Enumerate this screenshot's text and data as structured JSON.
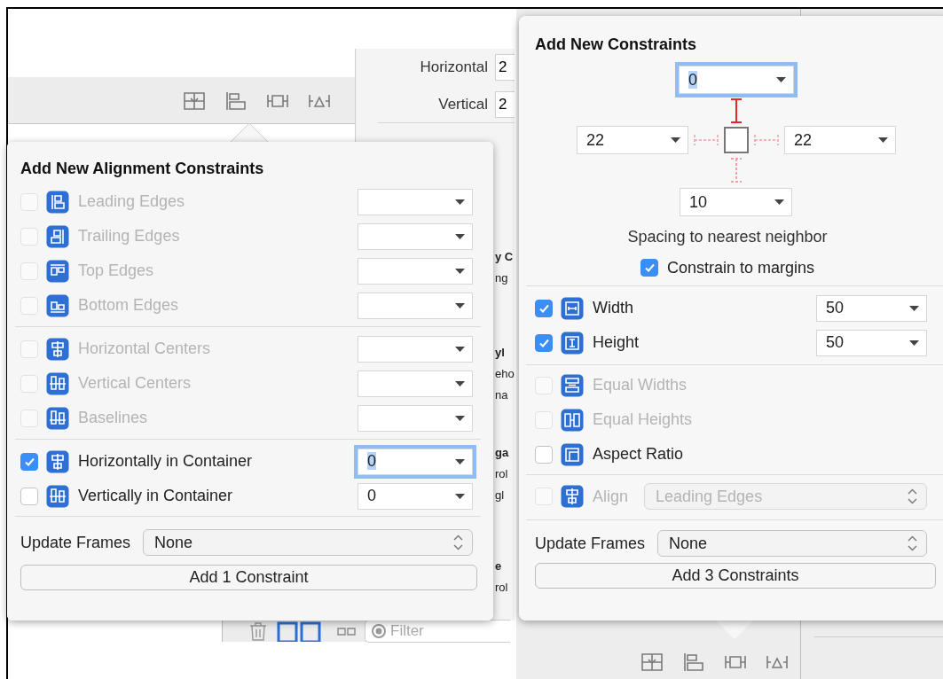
{
  "left_shot": {
    "inspector": {
      "fields": [
        {
          "label": "Horizontal",
          "value": "2"
        },
        {
          "label": "Vertical",
          "value": "2"
        }
      ],
      "fragments": [
        {
          "text": "y C",
          "kind": "heading"
        },
        {
          "text": "ng",
          "kind": "text"
        },
        {
          "text": "yl",
          "kind": "heading"
        },
        {
          "text": "eho",
          "kind": "text"
        },
        {
          "text": "na",
          "kind": "text"
        },
        {
          "text": "ga",
          "kind": "heading"
        },
        {
          "text": "rol",
          "kind": "text"
        },
        {
          "text": "gl",
          "kind": "text"
        },
        {
          "text": "e",
          "kind": "heading"
        },
        {
          "text": "rol",
          "kind": "text"
        }
      ]
    },
    "popover": {
      "title": "Add New Alignment Constraints",
      "groups": [
        [
          {
            "label": "Leading Edges",
            "checked": false,
            "disabled": true,
            "focused": false
          },
          {
            "label": "Trailing Edges",
            "checked": false,
            "disabled": true,
            "focused": false
          },
          {
            "label": "Top Edges",
            "checked": false,
            "disabled": true,
            "focused": false
          },
          {
            "label": "Bottom Edges",
            "checked": false,
            "disabled": true,
            "focused": false
          }
        ],
        [
          {
            "label": "Horizontal Centers",
            "checked": false,
            "disabled": true,
            "focused": false
          },
          {
            "label": "Vertical Centers",
            "checked": false,
            "disabled": true,
            "focused": false
          },
          {
            "label": "Baselines",
            "checked": false,
            "disabled": true,
            "focused": false
          }
        ],
        [
          {
            "label": "Horizontally in Container",
            "checked": true,
            "disabled": false,
            "value": "0",
            "focused": true
          },
          {
            "label": "Vertically in Container",
            "checked": false,
            "disabled": false,
            "value": "0",
            "focused": false
          }
        ]
      ],
      "update_frames": {
        "label": "Update Frames",
        "value": "None"
      },
      "button": "Add 1 Constraint"
    },
    "bottom_bar": {
      "filter_placeholder": "Filter"
    }
  },
  "right_shot": {
    "popover": {
      "title": "Add New Constraints",
      "spacing": {
        "top": {
          "value": "0",
          "active": true,
          "focused": true
        },
        "left": {
          "value": "22",
          "active": false,
          "focused": false
        },
        "right": {
          "value": "22",
          "active": false,
          "focused": false
        },
        "bottom": {
          "value": "10",
          "active": false,
          "focused": false
        }
      },
      "spacing_label": "Spacing to nearest neighbor",
      "margins": {
        "label": "Constrain to margins",
        "checked": true
      },
      "size_rows": [
        {
          "label": "Width",
          "checked": true,
          "disabled": false,
          "value": "50",
          "focused": false
        },
        {
          "label": "Height",
          "checked": true,
          "disabled": false,
          "value": "50",
          "focused": false
        }
      ],
      "equal_rows": [
        {
          "label": "Equal Widths",
          "checked": false,
          "disabled": true
        },
        {
          "label": "Equal Heights",
          "checked": false,
          "disabled": true
        },
        {
          "label": "Aspect Ratio",
          "checked": false,
          "disabled": false
        }
      ],
      "align": {
        "label": "Align",
        "checked": false,
        "disabled": true,
        "value": "Leading Edges"
      },
      "update_frames": {
        "label": "Update Frames",
        "value": "None"
      },
      "button": "Add 3 Constraints"
    }
  }
}
